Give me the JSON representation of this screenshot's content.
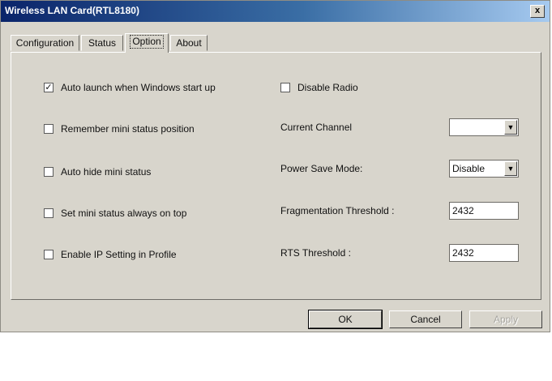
{
  "window": {
    "title": "Wireless LAN Card(RTL8180)",
    "close_label": "x"
  },
  "tabs": [
    {
      "label": "Configuration"
    },
    {
      "label": "Status"
    },
    {
      "label": "Option"
    },
    {
      "label": "About"
    }
  ],
  "options": {
    "auto_launch": {
      "label": "Auto launch when Windows start up",
      "checked": true
    },
    "remember_position": {
      "label": "Remember mini status position",
      "checked": false
    },
    "auto_hide": {
      "label": "Auto hide mini status",
      "checked": false
    },
    "always_on_top": {
      "label": "Set mini status always on top",
      "checked": false
    },
    "enable_ip": {
      "label": "Enable IP Setting in Profile",
      "checked": false
    },
    "disable_radio": {
      "label": "Disable Radio",
      "checked": false
    }
  },
  "settings": {
    "current_channel": {
      "label": "Current Channel",
      "value": ""
    },
    "power_save": {
      "label": "Power Save Mode:",
      "value": "Disable"
    },
    "fragmentation": {
      "label": "Fragmentation Threshold :",
      "value": "2432"
    },
    "rts": {
      "label": "RTS Threshold :",
      "value": "2432"
    }
  },
  "buttons": {
    "ok": "OK",
    "cancel": "Cancel",
    "apply": "Apply"
  },
  "glyphs": {
    "check": "✓",
    "dropdown_arrow": "▼"
  }
}
